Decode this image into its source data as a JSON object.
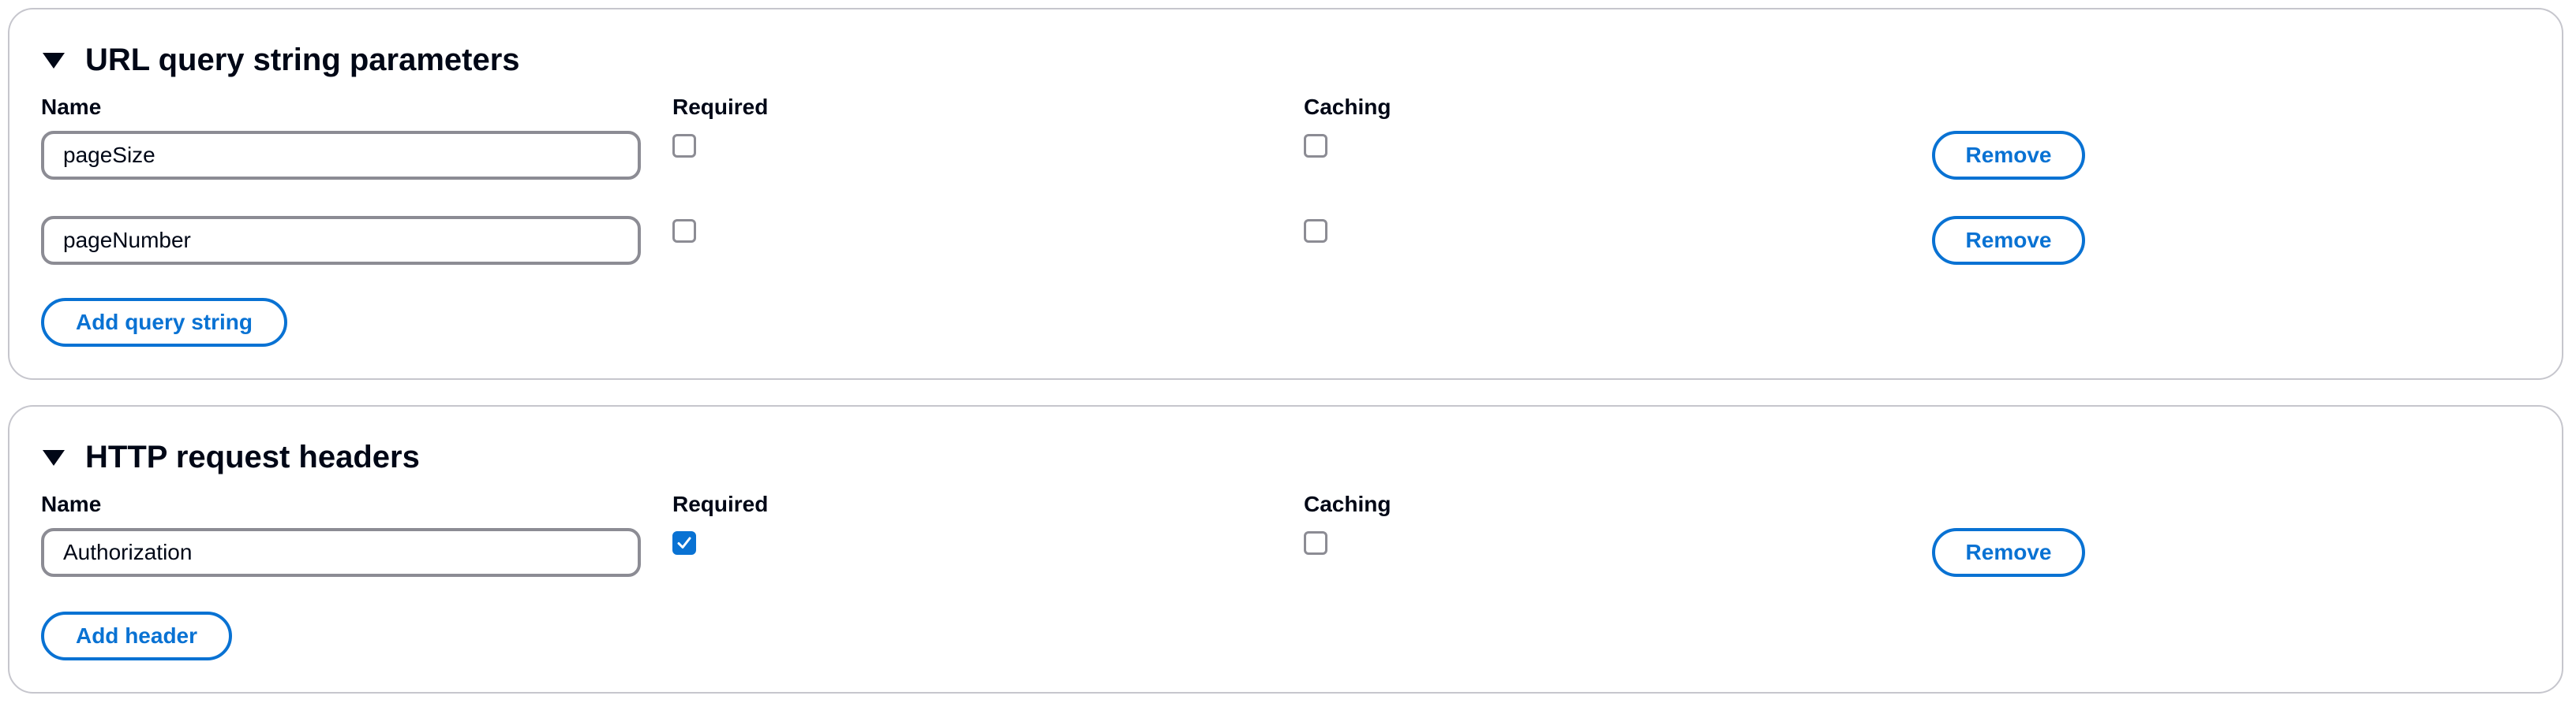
{
  "query_section": {
    "title": "URL query string parameters",
    "columns": {
      "name": "Name",
      "required": "Required",
      "caching": "Caching"
    },
    "rows": [
      {
        "name": "pageSize",
        "required": false,
        "caching": false,
        "remove_label": "Remove"
      },
      {
        "name": "pageNumber",
        "required": false,
        "caching": false,
        "remove_label": "Remove"
      }
    ],
    "add_label": "Add query string"
  },
  "headers_section": {
    "title": "HTTP request headers",
    "columns": {
      "name": "Name",
      "required": "Required",
      "caching": "Caching"
    },
    "rows": [
      {
        "name": "Authorization",
        "required": true,
        "caching": false,
        "remove_label": "Remove"
      }
    ],
    "add_label": "Add header"
  },
  "colors": {
    "accent": "#0972d3",
    "border": "#c6c6cd",
    "input_border": "#8c8c94",
    "text": "#000716"
  }
}
